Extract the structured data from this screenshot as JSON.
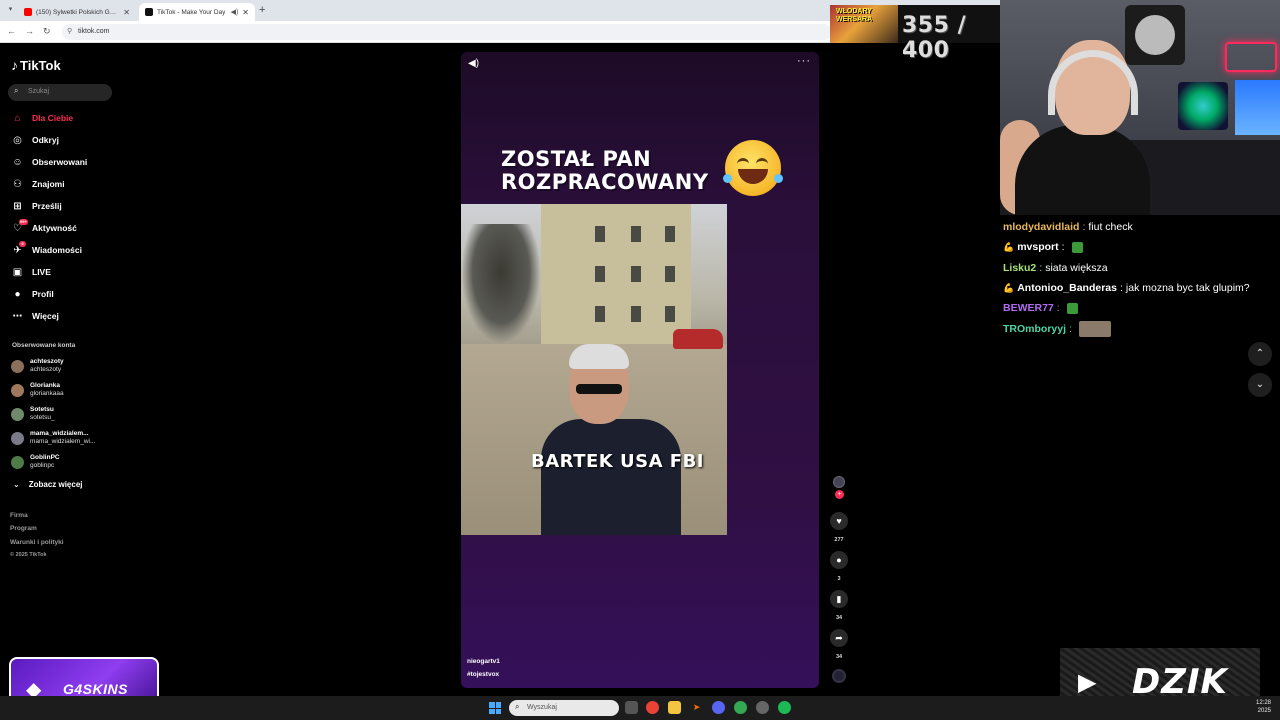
{
  "browser": {
    "tabs": [
      {
        "title": "(150) Sylwetki Polskich Gangste",
        "favicon_color": "#ff0000",
        "active": false
      },
      {
        "title": "TikTok - Make Your Day",
        "favicon_color": "#111111",
        "active": true
      }
    ],
    "url": "tiktok.com"
  },
  "sidebar": {
    "logo": "TikTok",
    "search_placeholder": "Szukaj",
    "nav": [
      {
        "label": "Dla Ciebie",
        "icon": "home-icon",
        "glyph": "⌂",
        "active": true
      },
      {
        "label": "Odkryj",
        "icon": "compass-icon",
        "glyph": "◎"
      },
      {
        "label": "Obserwowani",
        "icon": "following-icon",
        "glyph": "☺"
      },
      {
        "label": "Znajomi",
        "icon": "friends-icon",
        "glyph": "⚇"
      },
      {
        "label": "Prześlij",
        "icon": "upload-icon",
        "glyph": "⊞"
      },
      {
        "label": "Aktywność",
        "icon": "activity-icon",
        "glyph": "♡",
        "badge": "99+"
      },
      {
        "label": "Wiadomości",
        "icon": "messages-icon",
        "glyph": "✈",
        "badge": "9"
      },
      {
        "label": "LIVE",
        "icon": "live-icon",
        "glyph": "▣"
      },
      {
        "label": "Profil",
        "icon": "profile-icon",
        "glyph": "●"
      },
      {
        "label": "Więcej",
        "icon": "more-icon",
        "glyph": "⋯"
      }
    ],
    "following_heading": "Obserwowane konta",
    "following": [
      {
        "name": "achteszoty",
        "handle": "achteszoty",
        "color": "#8a6f5a"
      },
      {
        "name": "Glorianka",
        "handle": "gloriankaaa",
        "color": "#a0785e"
      },
      {
        "name": "Sotetsu",
        "handle": "sotetsu_",
        "color": "#6f8a6a"
      },
      {
        "name": "mama_widzialem...",
        "handle": "mama_widzialem_wi...",
        "color": "#7a7a88"
      },
      {
        "name": "GoblinPC",
        "handle": "goblinpc",
        "color": "#4f7a4a"
      }
    ],
    "see_more": "Zobacz więcej",
    "footer": [
      "Firma",
      "Program",
      "Warunki i polityki"
    ],
    "copyright": "© 2025 TikTok"
  },
  "video": {
    "caption_line1": "ZOSTAŁ PAN",
    "caption_line2": "ROZPRACOWANY",
    "subtitle": "BARTEK USA FBI",
    "author": "nieogartv1",
    "hashtag": "#tojestvox",
    "likes": "277",
    "comments": "3",
    "saves": "34",
    "shares": "34"
  },
  "stream": {
    "counter": "355 / 400",
    "counter_thumb_text": "WŁODARY WERSARA",
    "chat": [
      {
        "user": "mlodydavidlaid",
        "color": "#e8b85a",
        "text": "fiut check",
        "badge": ""
      },
      {
        "user": "mvsport",
        "color": "#ffffff",
        "text": "",
        "badge": "💪",
        "emote": true
      },
      {
        "user": "Lisku2",
        "color": "#a5e07a",
        "text": "siata większa",
        "badge": ""
      },
      {
        "user": "Antonioo_Banderas",
        "color": "#ffffff",
        "text": "jak mozna byc tak glupim?",
        "badge": "💪"
      },
      {
        "user": "BEWER77",
        "color": "#b06cf0",
        "text": "",
        "badge": "",
        "emote": true
      },
      {
        "user": "TROmboryyj",
        "color": "#4fd4a8",
        "text": "",
        "badge": "",
        "emote_big": true
      }
    ],
    "sponsor1": "G4SKINS",
    "sponsor2": "DZIK"
  },
  "taskbar": {
    "search_placeholder": "Wyszukaj",
    "time": "12:28",
    "date": "2025"
  }
}
